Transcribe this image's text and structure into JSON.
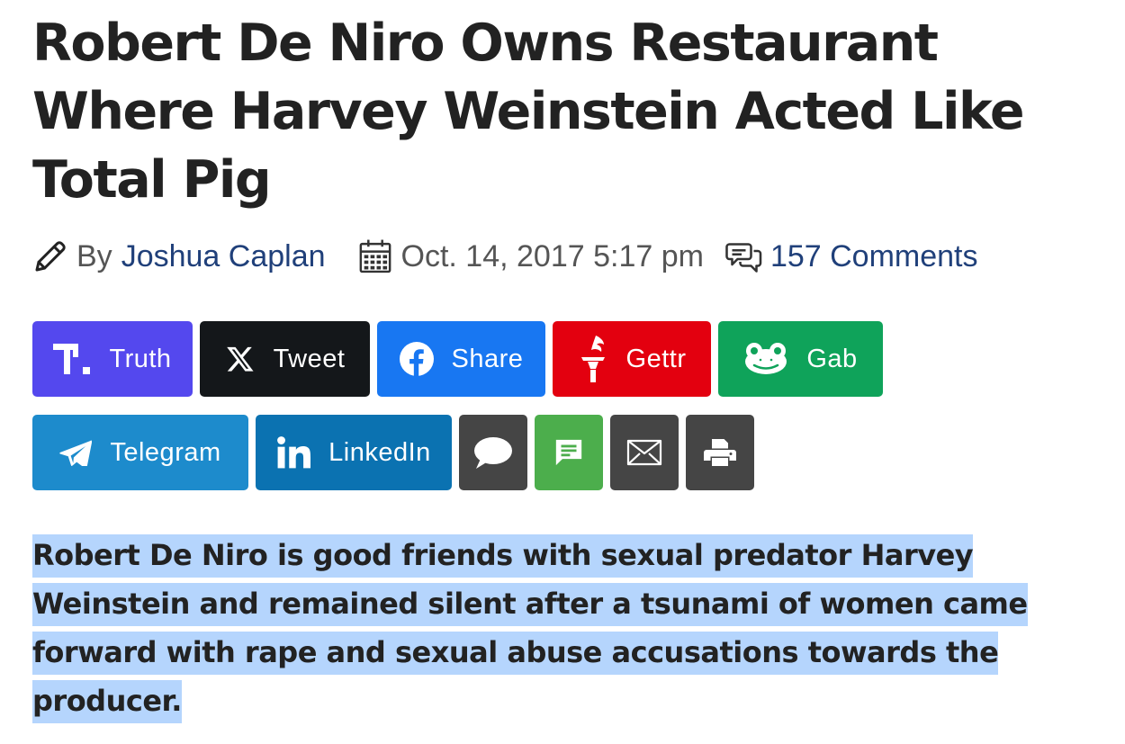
{
  "article": {
    "headline": "Robert De Niro Owns Restaurant Where Harvey Weinstein Acted Like Total Pig",
    "byline_prefix": "By",
    "author": "Joshua Caplan",
    "date": "Oct. 14, 2017 5:17 pm",
    "comments": "157 Comments",
    "intro": "Robert De Niro is good friends with sexual predator Harvey Weinstein and remained silent after a tsunami of women came forward with rape and sexual abuse accusations towards the producer."
  },
  "share_buttons": {
    "truth": {
      "label": "Truth",
      "color": "#5448ee",
      "icon": "truth-social-icon"
    },
    "tweet": {
      "label": "Tweet",
      "color": "#14171a",
      "icon": "x-icon"
    },
    "share": {
      "label": "Share",
      "color": "#1877f2",
      "icon": "facebook-icon"
    },
    "gettr": {
      "label": "Gettr",
      "color": "#e3000f",
      "icon": "gettr-torch-icon"
    },
    "gab": {
      "label": "Gab",
      "color": "#0fa35a",
      "icon": "gab-frog-icon"
    },
    "telegram": {
      "label": "Telegram",
      "color": "#1d8bcc",
      "icon": "telegram-plane-icon"
    },
    "linkedin": {
      "label": "LinkedIn",
      "color": "#0b72b1",
      "icon": "linkedin-icon"
    },
    "comment": {
      "color": "#454545",
      "icon": "speech-bubble-icon"
    },
    "sms": {
      "color": "#4cae4c",
      "icon": "sms-icon"
    },
    "email": {
      "color": "#454545",
      "icon": "envelope-icon"
    },
    "print": {
      "color": "#454545",
      "icon": "printer-icon"
    }
  },
  "colors": {
    "link": "#20407a",
    "meta_text": "#555555",
    "selection_highlight": "#b5d5fd"
  }
}
